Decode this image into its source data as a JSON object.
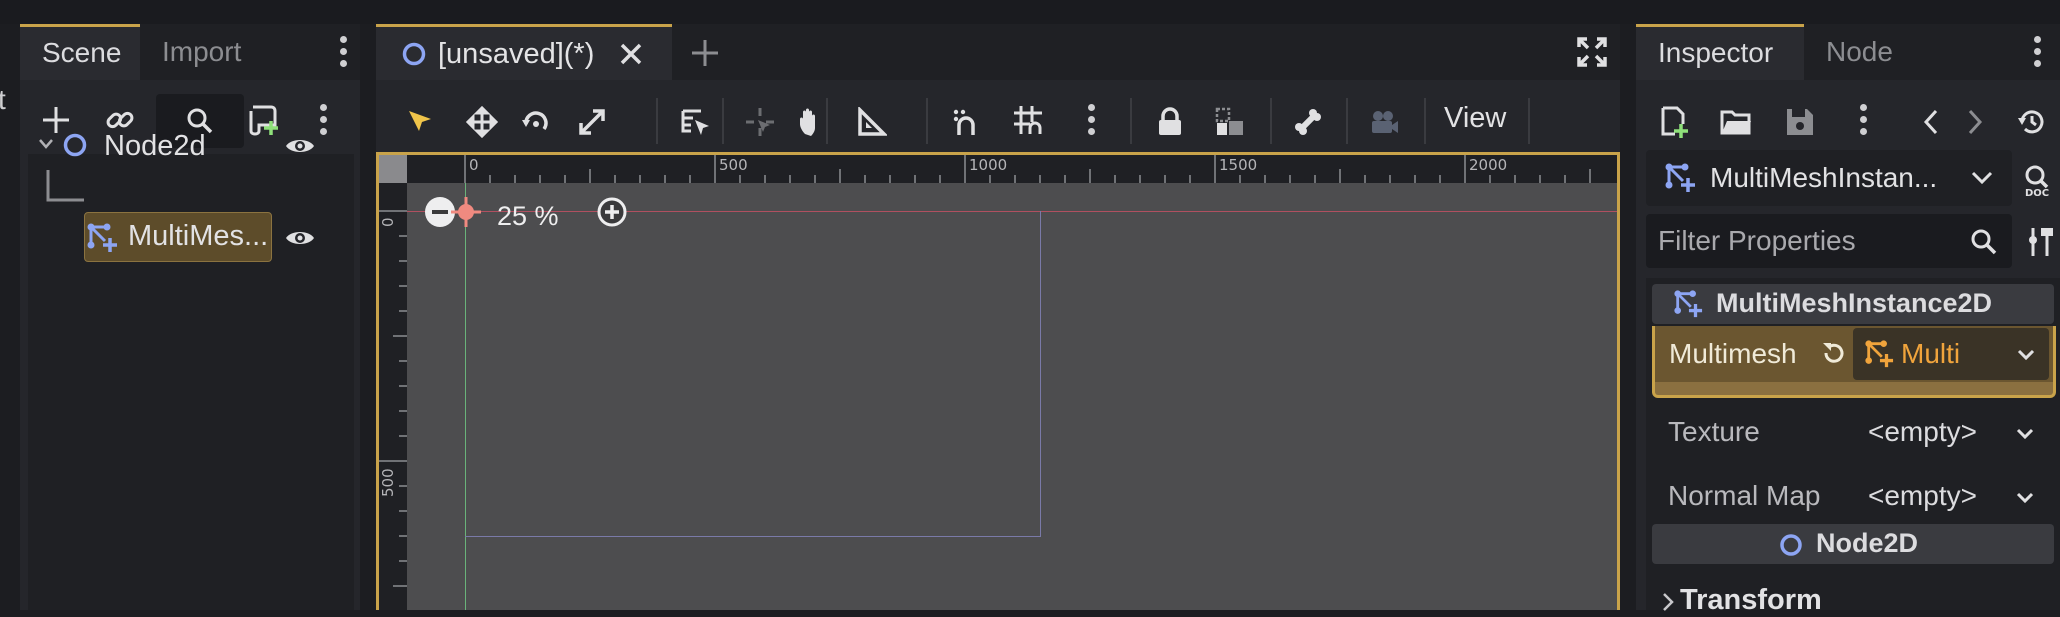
{
  "app": {
    "edge_text": "t"
  },
  "scene_panel": {
    "tabs": [
      {
        "label": "Scene"
      },
      {
        "label": "Import"
      }
    ],
    "toolbar": [
      "add-node-icon",
      "link-icon",
      "search-icon",
      "script-add-icon",
      "more-icon"
    ],
    "tree": [
      {
        "label": "Node2d",
        "icon": "node2d-icon",
        "visible": true
      },
      {
        "label": "MultiMes...",
        "icon": "multimesh-icon",
        "visible": true,
        "selected": true
      }
    ]
  },
  "viewport": {
    "tab": {
      "label": "[unsaved](*)"
    },
    "view_menu": "View",
    "zoom": "25 %",
    "ruler_x": [
      "0",
      "500",
      "1000",
      "1500",
      "2000"
    ],
    "ruler_y": [
      "0",
      "500"
    ]
  },
  "inspector": {
    "tabs": [
      {
        "label": "Inspector"
      },
      {
        "label": "Node"
      }
    ],
    "object": "MultiMeshInstan...",
    "filter_placeholder": "Filter Properties",
    "class_header": "MultiMeshInstance2D",
    "multimesh": {
      "label": "Multimesh",
      "value": "Multi"
    },
    "properties": [
      {
        "label": "Texture",
        "value": "<empty>"
      },
      {
        "label": "Normal Map",
        "value": "<empty>"
      }
    ],
    "node_header": "Node2D",
    "section": "Transform"
  },
  "colors": {
    "accent": "#c9a34a",
    "node_blue": "#8da5f3",
    "mesh_orange": "#f0a43c",
    "bg": "#1c1d21"
  }
}
